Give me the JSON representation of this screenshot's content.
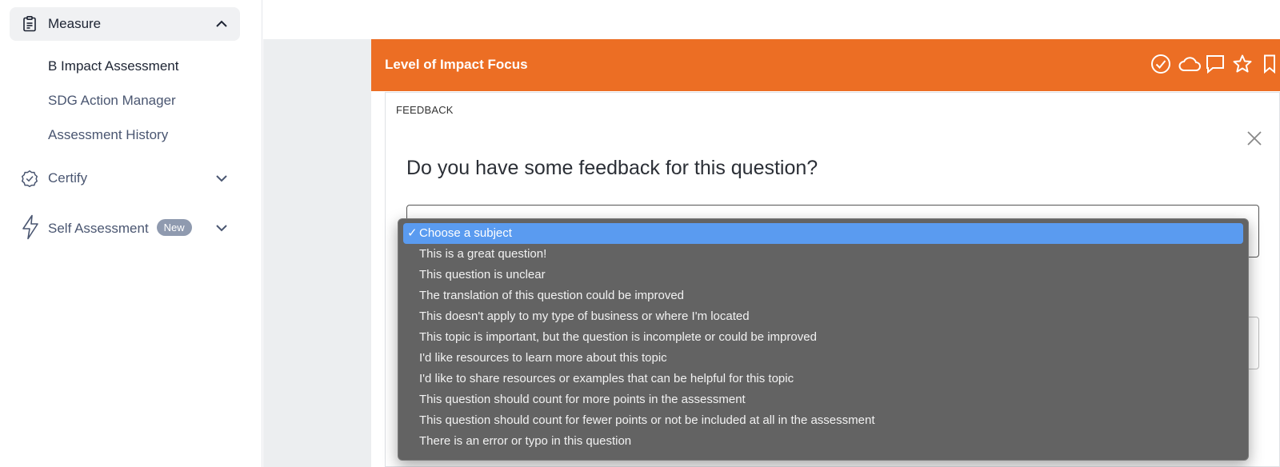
{
  "sidebar": {
    "measure": {
      "label": "Measure"
    },
    "sub_items": [
      {
        "label": "B Impact Assessment"
      },
      {
        "label": "SDG Action Manager"
      },
      {
        "label": "Assessment History"
      }
    ],
    "certify": {
      "label": "Certify"
    },
    "self_assessment": {
      "label": "Self Assessment",
      "badge": "New"
    }
  },
  "card": {
    "title": "Level of Impact Focus",
    "icons": [
      "check-circle-icon",
      "cloud-icon",
      "comment-icon",
      "star-icon",
      "bookmark-icon"
    ],
    "accent_color": "#ec6e24"
  },
  "feedback": {
    "label": "FEEDBACK",
    "question": "Do you have some feedback for this question?"
  },
  "dropdown": {
    "selected_index": 0,
    "options": [
      {
        "label": "Choose a subject"
      },
      {
        "label": "This is a great question!"
      },
      {
        "label": "This question is unclear"
      },
      {
        "label": "The translation of this question could be improved"
      },
      {
        "label": "This doesn't apply to my type of business or where I'm located"
      },
      {
        "label": "This topic is important, but the question is incomplete or could be improved"
      },
      {
        "label": "I'd like resources to learn more about this topic"
      },
      {
        "label": "I'd like to share resources or examples that can be helpful for this topic"
      },
      {
        "label": "This question should count for more points in the assessment"
      },
      {
        "label": "This question should count for fewer points or not be included at all in the assessment"
      },
      {
        "label": "There is an error or typo in this question"
      }
    ],
    "highlight_color": "#5a9bf0"
  }
}
